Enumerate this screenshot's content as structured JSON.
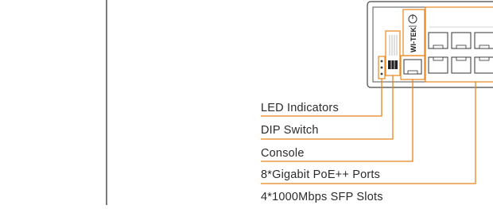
{
  "device": {
    "brand": "WI-TEK",
    "accent_color": "#e8851c",
    "panel_color": "#444444"
  },
  "callouts": [
    {
      "label": "LED Indicators"
    },
    {
      "label": "DIP Switch"
    },
    {
      "label": "Console"
    },
    {
      "label": "8*Gigabit PoE++ Ports"
    },
    {
      "label": "4*1000Mbps SFP Slots"
    }
  ]
}
